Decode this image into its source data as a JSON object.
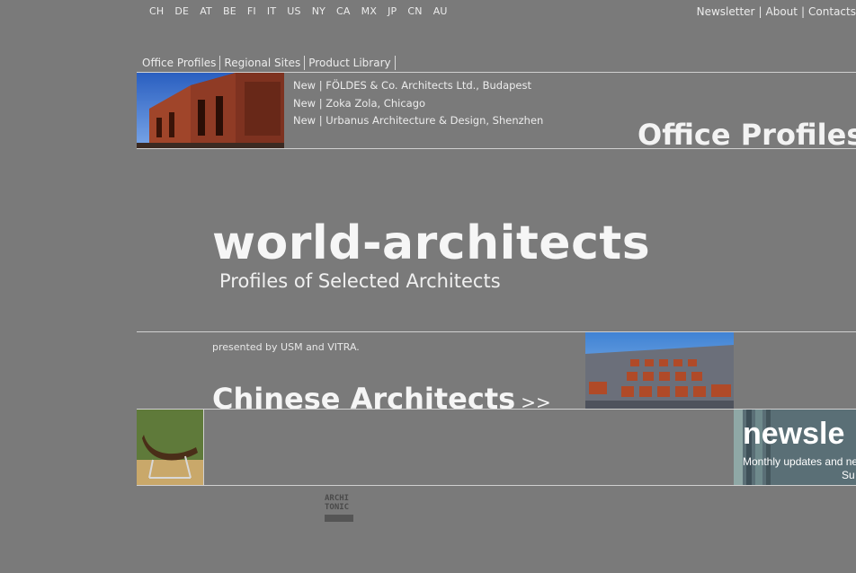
{
  "countries": [
    "CH",
    "DE",
    "AT",
    "BE",
    "FI",
    "IT",
    "US",
    "NY",
    "CA",
    "MX",
    "JP",
    "CN",
    "AU"
  ],
  "top_links": {
    "newsletter": "Newsletter",
    "about": "About",
    "contacts": "Contacts",
    "separator": "|"
  },
  "tabs": [
    "Office Profiles",
    "Regional Sites",
    "Product Library"
  ],
  "news": [
    "New | FÖLDES & Co. Architects Ltd., Budapest",
    "New | Zoka Zola, Chicago",
    "New | Urbanus Architecture & Design, Shenzhen"
  ],
  "office_profiles_heading": "Office Profiles",
  "logo": {
    "title": "world-architects",
    "subtitle": "Profiles of Selected Architects"
  },
  "presented": "presented by USM and VITRA.",
  "chinese": {
    "label": "Chinese Architects",
    "arrow": ">>"
  },
  "newsletter_banner": {
    "title": "newsle",
    "line1": "Monthly updates and ne",
    "line2": "Su"
  },
  "archi_logo": {
    "line1": "ARCHI",
    "line2": "TONIC"
  },
  "colors": {
    "background": "#7a7a7a",
    "text": "#ececec",
    "rule": "#d0d0d0"
  }
}
